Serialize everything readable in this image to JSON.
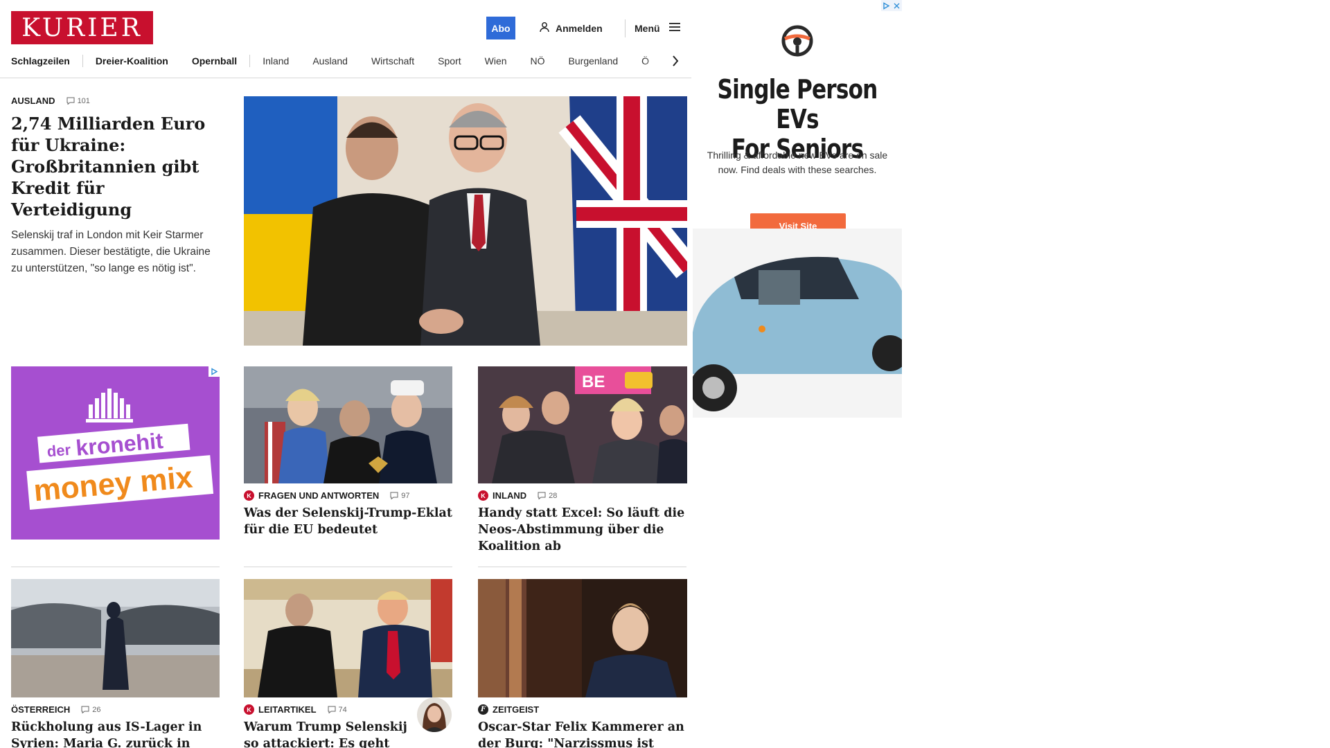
{
  "header": {
    "logo": "KURIER",
    "abo_label": "Abo",
    "login_label": "Anmelden",
    "menu_label": "Menü"
  },
  "nav": {
    "items": [
      "Schlagzeilen",
      "Dreier-Koalition",
      "Opernball",
      "Inland",
      "Ausland",
      "Wirtschaft",
      "Sport",
      "Wien",
      "NÖ",
      "Burgenland",
      "Ö"
    ]
  },
  "lead": {
    "kicker": "AUSLAND",
    "comments": "101",
    "title": "2,74 Milliarden Euro für Ukraine: Großbritannien gibt Kredit für Verteidigung",
    "teaser": "Selenskij traf in London mit Keir Starmer zusammen. Dieser bestätigte, die Ukraine zu unterstützen, \"so lange es nötig ist\"."
  },
  "kronehit_ad": {
    "line1_small": "der",
    "line1_big": "kronehit",
    "line2": "money mix"
  },
  "cards": [
    {
      "badge": "K",
      "kicker": "FRAGEN UND ANTWORTEN",
      "comments": "97",
      "title": "Was der Selenskij-Trump-Eklat für die EU bedeutet"
    },
    {
      "badge": "K",
      "kicker": "INLAND",
      "comments": "28",
      "title": "Handy statt Excel: So läuft die Neos-Abstimmung über die Koalition ab"
    },
    {
      "badge": "",
      "kicker": "ÖSTERREICH",
      "comments": "26",
      "title": "Rückholung aus IS-Lager in Syrien: Maria G. zurück in Österreich"
    },
    {
      "badge": "K",
      "kicker": "LEITARTIKEL",
      "comments": "74",
      "title": "Warum Trump Selenskij so attackiert: Es geht um Dollars, nicht um Frieden"
    },
    {
      "badge": "f",
      "kicker": "ZEITGEIST",
      "comments": "",
      "title": "Oscar-Star Felix Kammerer an der Burg: \"Narzissmus ist tödlich\""
    }
  ],
  "ev_ad": {
    "headline_line1": "Single Person EVs",
    "headline_line2": "For Seniors",
    "body": "Thrilling & affordable new EVs are on sale now. Find deals with these searches.",
    "button": "Visit Site"
  },
  "colors": {
    "brand_red": "#c8102e",
    "abo_blue": "#2f6bd8",
    "ad_purple": "#a64fd0",
    "ad_orange": "#f26a3d"
  }
}
